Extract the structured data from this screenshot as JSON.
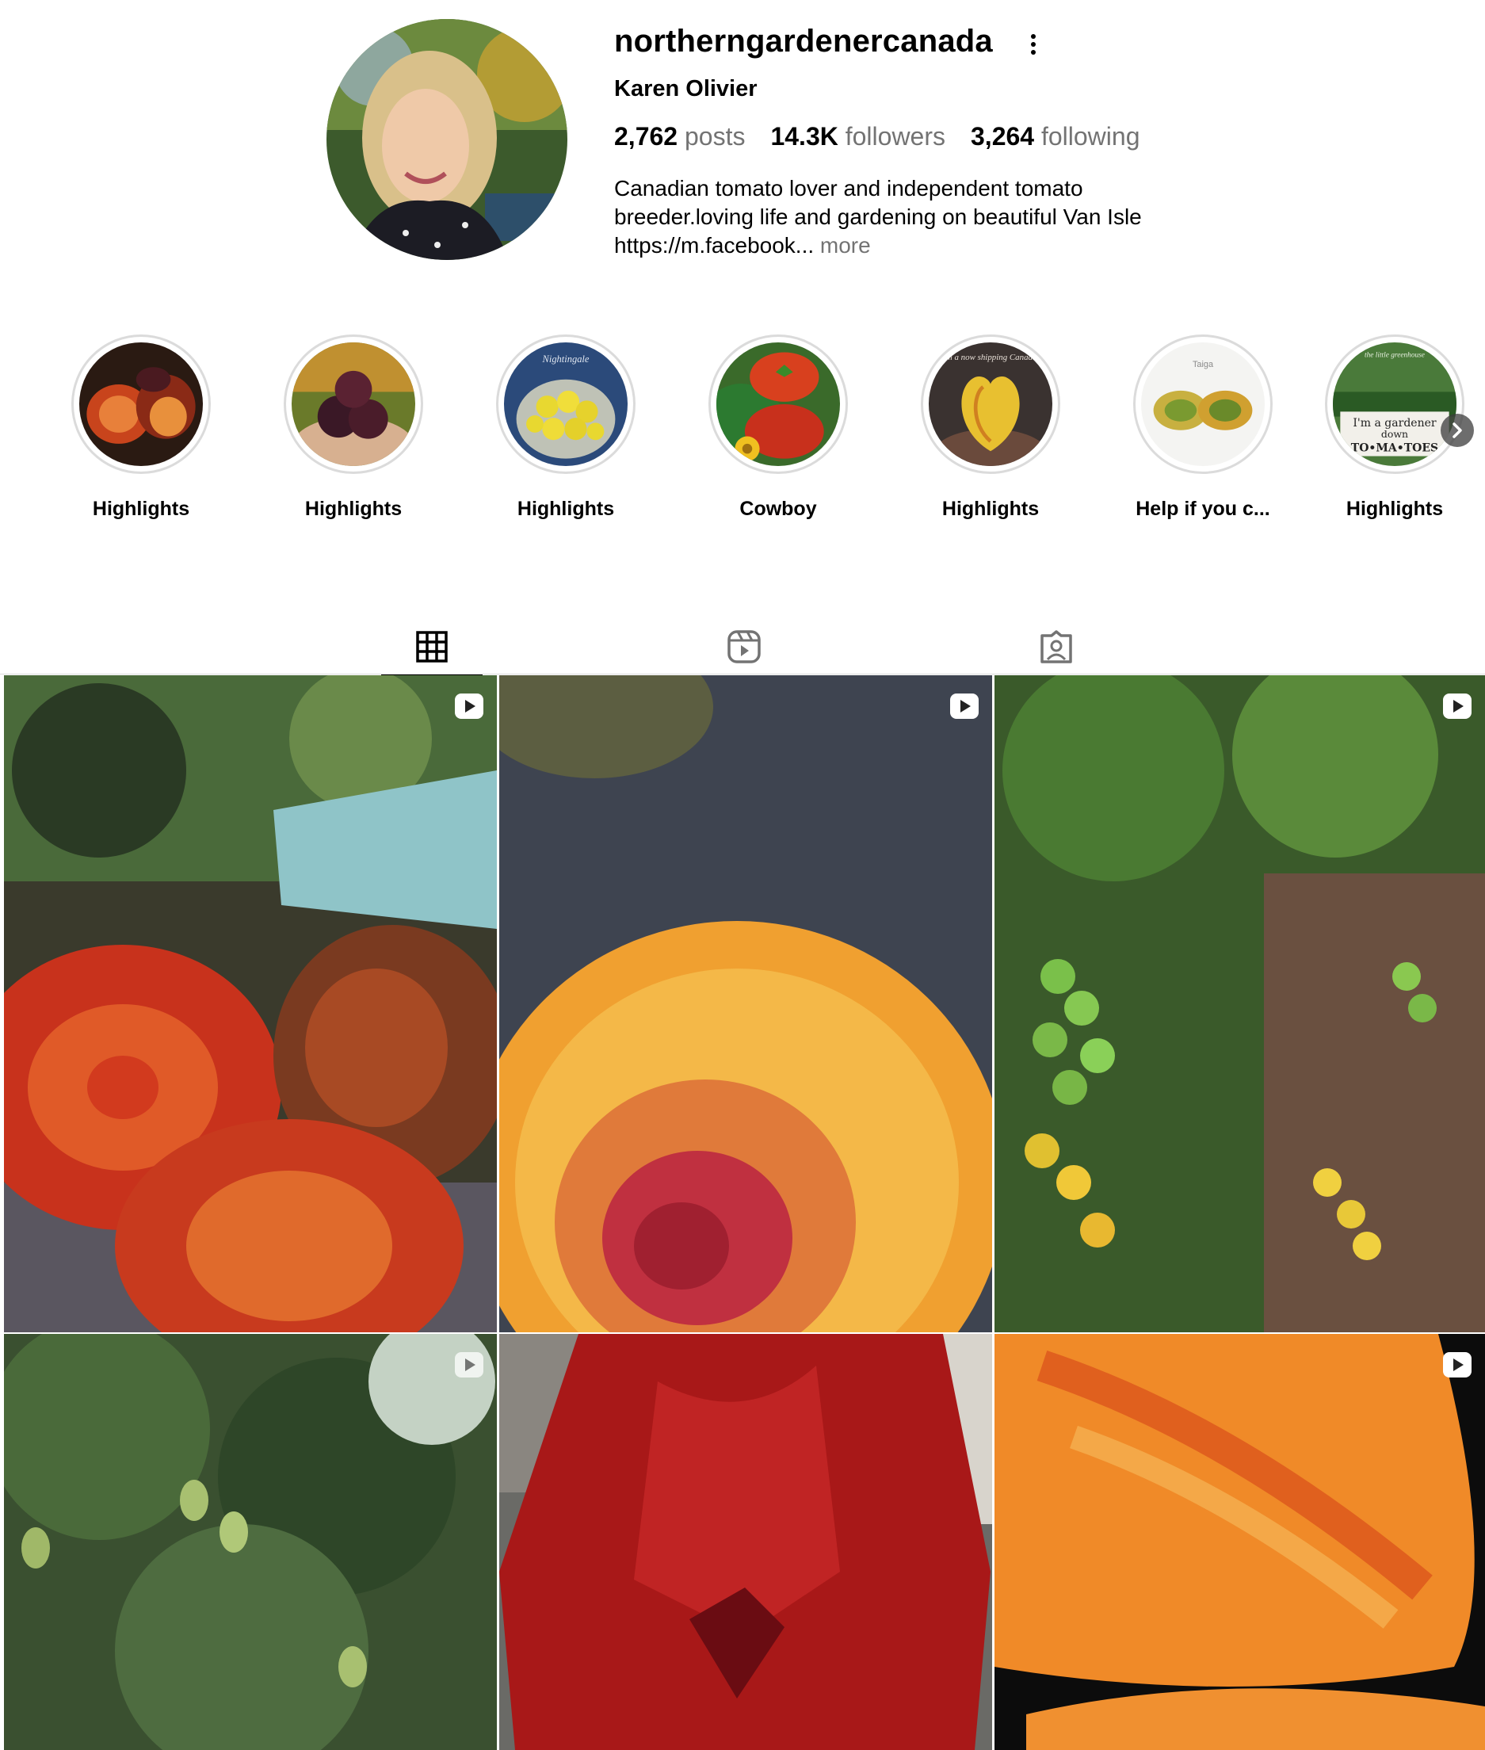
{
  "profile": {
    "username": "northerngardenercanada",
    "full_name": "Karen Olivier",
    "stats": {
      "posts": "2,762",
      "posts_label": "posts",
      "followers": "14.3K",
      "followers_label": "followers",
      "following": "3,264",
      "following_label": "following"
    },
    "bio_line1": "Canadian tomato lover and independent tomato",
    "bio_line2": "breeder.loving life and gardening on beautiful Van Isle",
    "bio_line3": "https://m.facebook...",
    "bio_more": "more"
  },
  "highlights": [
    {
      "label": "Highlights",
      "icon": "sliced-tomato-thumbnail"
    },
    {
      "label": "Highlights",
      "icon": "dark-tomatoes-in-hand-thumbnail"
    },
    {
      "label": "Highlights",
      "icon": "yellow-tomatoes-bowl-thumbnail",
      "overlay_text": "Nightingale"
    },
    {
      "label": "Cowboy",
      "icon": "red-tomatoes-thumbnail"
    },
    {
      "label": "Highlights",
      "icon": "heart-tomato-thumbnail",
      "overlay_text": "I'm a now shipping Canada!"
    },
    {
      "label": "Help if you c...",
      "icon": "taiga-tomato-thumbnail",
      "overlay_text": "Taiga"
    },
    {
      "label": "Highlights",
      "icon": "gardener-sign-thumbnail",
      "overlay_text": "the little greenhouse",
      "sign_line1": "I'm a gardener",
      "sign_line2": "down",
      "sign_line3": "TO•MA•TOES"
    }
  ],
  "tabs": [
    {
      "name": "posts",
      "icon": "grid-icon",
      "active": true
    },
    {
      "name": "reels",
      "icon": "reels-icon",
      "active": false
    },
    {
      "name": "tagged",
      "icon": "tagged-user-icon",
      "active": false
    }
  ],
  "posts": [
    {
      "subject": "sliced dark tomatoes",
      "reel": true
    },
    {
      "subject": "sliced orange tomato closeup",
      "reel": true
    },
    {
      "subject": "tomato plants with green and yellow fruit",
      "reel": true
    },
    {
      "subject": "tomato plant leaves with green fruit",
      "reel": true
    },
    {
      "subject": "red amaryllis flower",
      "reel": false
    },
    {
      "subject": "orange tomato slice closeup",
      "reel": true
    }
  ],
  "colors": {
    "text": "#000000",
    "secondary": "#737373",
    "divider": "#dbdbdb"
  }
}
